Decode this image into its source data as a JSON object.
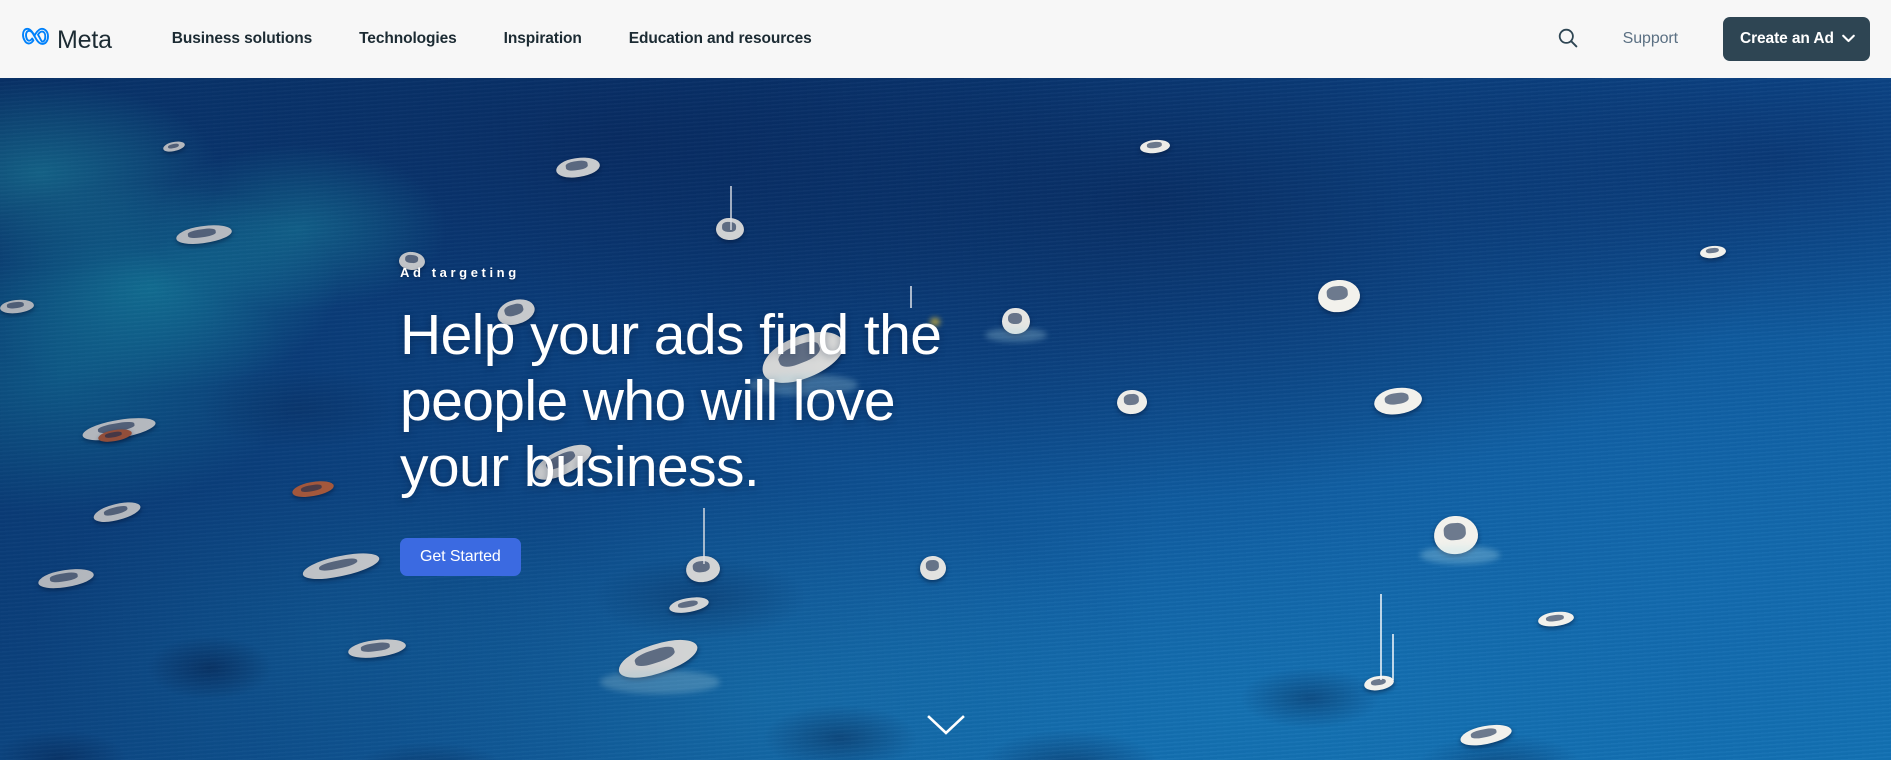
{
  "header": {
    "brand": {
      "logo_icon": "meta-infinity-icon",
      "wordmark": "Meta",
      "logo_color": "#0081fb"
    },
    "nav_items": [
      {
        "label": "Business solutions"
      },
      {
        "label": "Technologies"
      },
      {
        "label": "Inspiration"
      },
      {
        "label": "Education and resources"
      }
    ],
    "search_icon": "search-icon",
    "support_label": "Support",
    "cta": {
      "label": "Create an Ad",
      "chevron_icon": "chevron-down-icon",
      "background": "#2e4553",
      "text_color": "#ffffff"
    },
    "background": "#f7f7f7"
  },
  "hero": {
    "eyebrow": "Ad targeting",
    "headline": "Help your ads find the people who will love your business.",
    "cta_label": "Get Started",
    "cta_color": "#3b6ae1",
    "scroll_icon": "chevron-down-icon",
    "background_description": "Aerial photograph of turquoise and deep blue ocean with many white boats",
    "text_color": "#ffffff"
  }
}
